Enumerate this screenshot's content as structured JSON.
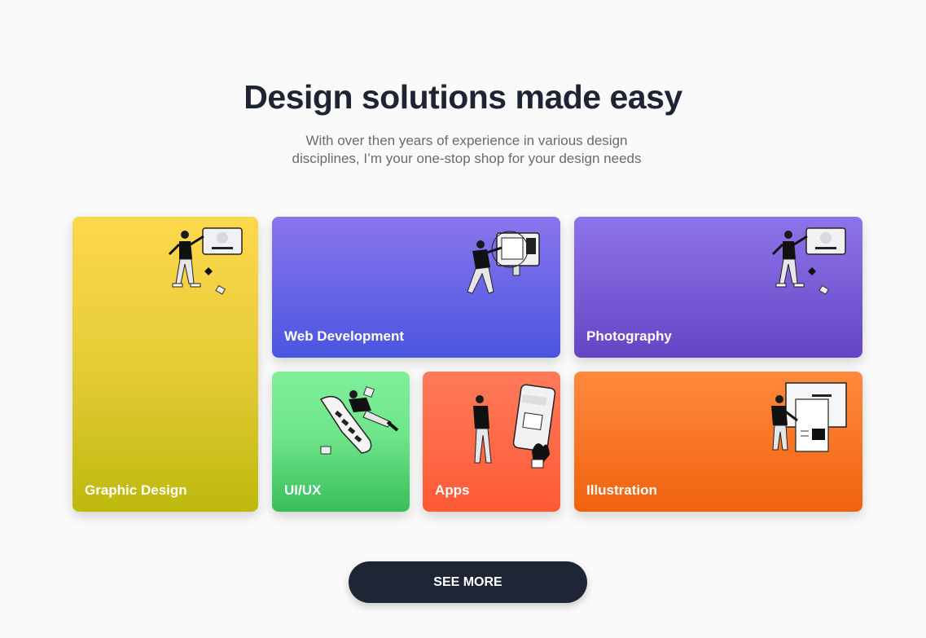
{
  "hero": {
    "title": "Design solutions made easy",
    "subtitle": "With over then years of experience in various design disciplines, I’m your one-stop shop for your design needs"
  },
  "cards": [
    {
      "id": "graphic-design",
      "label": "Graphic Design",
      "illustration": "person-presenting-illustration"
    },
    {
      "id": "web-development",
      "label": "Web Development",
      "illustration": "person-at-monitor-illustration"
    },
    {
      "id": "photography",
      "label": "Photography",
      "illustration": "person-presenting-illustration"
    },
    {
      "id": "ui-ux",
      "label": "UI/UX",
      "illustration": "person-with-filmstrip-illustration"
    },
    {
      "id": "apps",
      "label": "Apps",
      "illustration": "person-with-phone-illustration"
    },
    {
      "id": "illustration",
      "label": "Illustration",
      "illustration": "person-with-documents-illustration"
    }
  ],
  "cta": {
    "label": "SEE MORE"
  }
}
